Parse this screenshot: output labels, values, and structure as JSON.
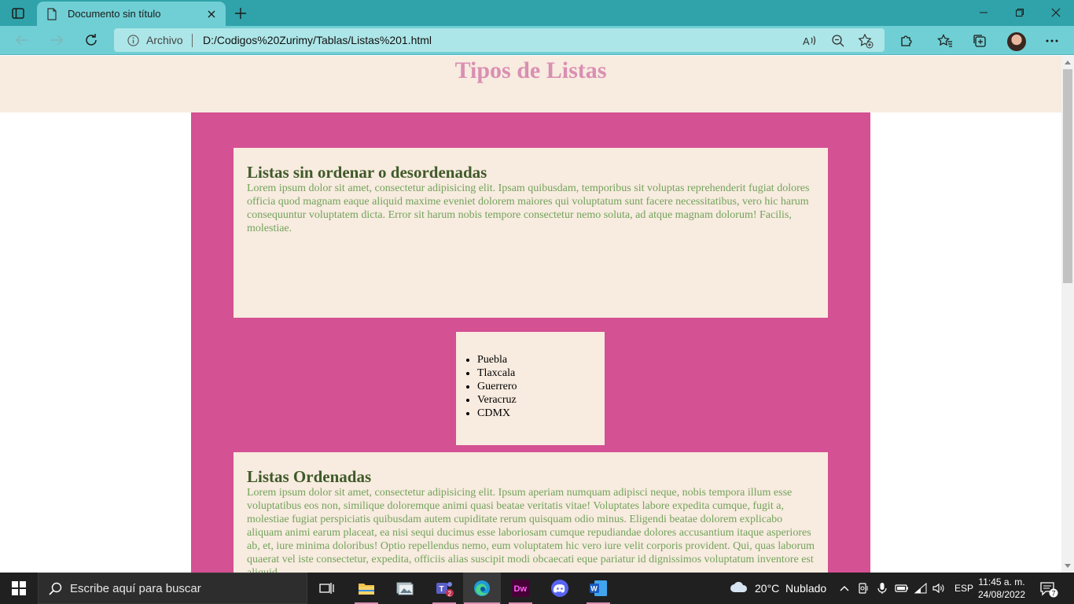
{
  "browser": {
    "tab_title": "Documento sin título",
    "scheme_label": "Archivo",
    "url": "D:/Codigos%20Zurimy/Tablas/Listas%201.html"
  },
  "page": {
    "title": "Tipos de Listas",
    "section1": {
      "heading": "Listas sin ordenar o desordenadas",
      "text": "Lorem ipsum dolor sit amet, consectetur adipisicing elit. Ipsam quibusdam, temporibus sit voluptas reprehenderit fugiat dolores officia quod magnam eaque aliquid maxime eveniet dolorem maiores qui voluptatum sunt facere necessitatibus, vero hic harum consequuntur voluptatem dicta. Error sit harum nobis tempore consectetur nemo soluta, ad atque magnam dolorum! Facilis, molestiae."
    },
    "list_items": [
      "Puebla",
      "Tlaxcala",
      "Guerrero",
      "Veracruz",
      "CDMX"
    ],
    "section2": {
      "heading": "Listas Ordenadas",
      "text": "Lorem ipsum dolor sit amet, consectetur adipisicing elit. Ipsum aperiam numquam adipisci neque, nobis tempora illum esse voluptatibus eos non, similique doloremque animi quasi beatae veritatis vitae! Voluptates labore expedita cumque, fugit a, molestiae fugiat perspiciatis quibusdam autem cupiditate rerum quisquam odio minus. Eligendi beatae dolorem explicabo aliquam animi earum placeat, ea nisi sequi ducimus esse laboriosam cumque repudiandae dolores accusantium itaque asperiores ab, et, iure minima doloribus! Optio repellendus nemo, eum voluptatem hic vero iure velit corporis provident. Qui, quas laborum quaerat vel iste consectetur, expedita, officiis alias suscipit modi obcaecati eque pariatur id dignissimos voluptatum inventore est aliquid."
    }
  },
  "taskbar": {
    "search_placeholder": "Escribe aquí para buscar",
    "weather": "20°C  Nublado",
    "language": "ESP",
    "time": "11:45 a. m.",
    "date": "24/08/2022",
    "teams_badge": "2",
    "notifications_count": "7"
  },
  "colors": {
    "tabbar": "#30a2a9",
    "toolbar": "#6fcfd4",
    "page_header_bg": "#f8ebdf",
    "title_color": "#d98fb3",
    "container_bg": "#d45193",
    "heading_color": "#3f5a2a",
    "paragraph_color": "#72a35c"
  }
}
